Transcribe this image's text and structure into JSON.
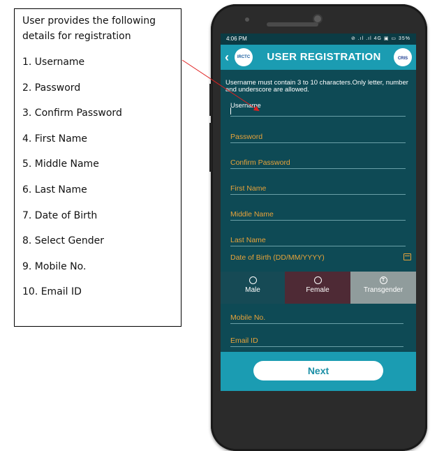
{
  "description": {
    "intro": "User provides the following details for registration",
    "items": [
      "1. Username",
      "2. Password",
      "3. Confirm Password",
      "4. First Name",
      "5. Middle Name",
      "6. Last Name",
      "7. Date of Birth",
      "8. Select Gender",
      "9. Mobile No.",
      "10. Email ID"
    ]
  },
  "statusbar": {
    "time": "4:06 PM",
    "icons": "⊘ .ıl .ıl 4G ▣ ▭ 35%"
  },
  "appbar": {
    "back_icon": "chevron-left-icon",
    "left_logo": "IRCTC",
    "title": "USER REGISTRATION",
    "right_logo": "CRIS"
  },
  "form": {
    "hint": "Username must contain 3 to 10 characters.Only letter, number and underscore are allowed.",
    "fields": {
      "username": "Username",
      "password": "Password",
      "confirm_password": "Confirm Password",
      "first_name": "First Name",
      "middle_name": "Middle Name",
      "last_name": "Last Name",
      "dob": "Date of Birth (DD/MM/YYYY)",
      "mobile": "Mobile No.",
      "email": "Email ID"
    },
    "gender": {
      "male": "Male",
      "female": "Female",
      "transgender": "Transgender"
    },
    "next_label": "Next"
  },
  "colors": {
    "screen_bg": "#0e4a55",
    "appbar": "#1b9cb2",
    "field_label": "#e8a33a",
    "female_selected": "#4e2a35",
    "transgender_bg": "#909c9c",
    "arrow": "#e02020"
  }
}
